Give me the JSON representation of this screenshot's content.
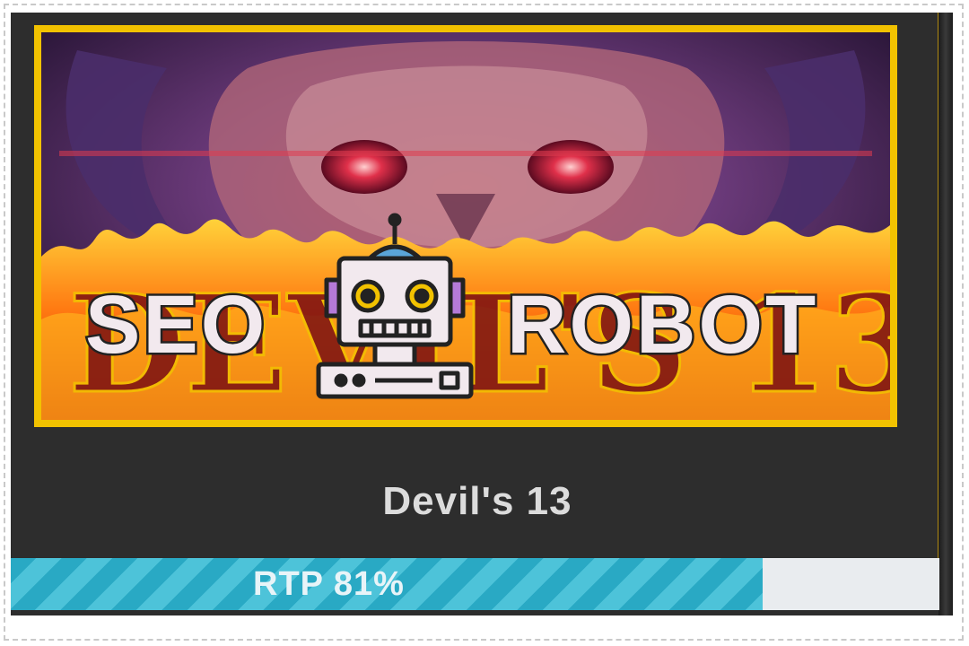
{
  "game": {
    "title": "Devil's 13",
    "art_icon": "devil-skull-flames-art",
    "rtp": {
      "label": "RTP 81%",
      "value_percent": 81
    }
  },
  "watermark": {
    "text_left": "SEO",
    "text_right": "ROBOT",
    "icon": "robot-icon"
  },
  "colors": {
    "frame_gold": "#f2c200",
    "card_bg": "#2d2d2d",
    "rtp_fill": "#29a9c4",
    "rtp_track": "#e9ecef",
    "title_text": "#dcdcdc"
  }
}
